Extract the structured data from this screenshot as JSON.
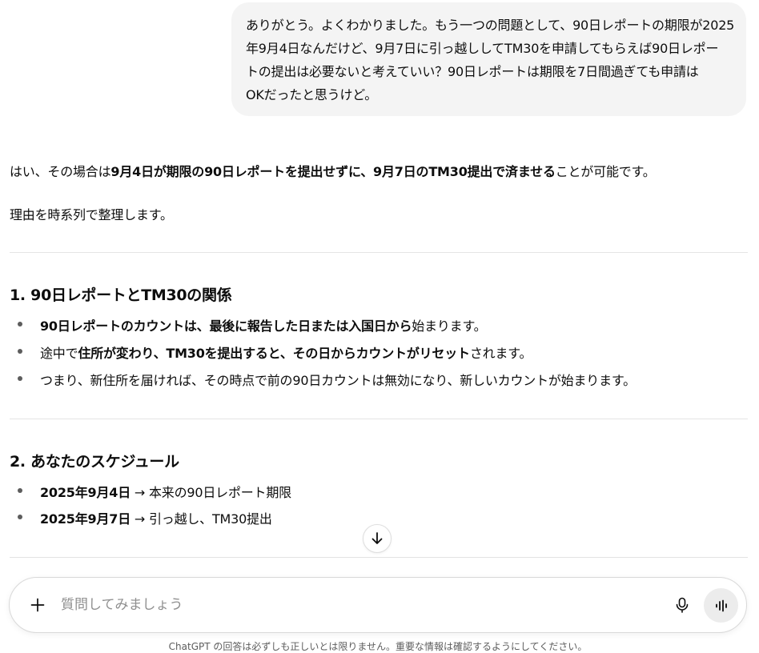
{
  "user_message": {
    "lines": [
      "ありがとう。よくわかりました。もう一つの問題として、90日レポートの期限が2025",
      "年9月4日なんだけど、9月7日に引っ越ししてTM30を申請してもらえば90日レポー",
      "トの提出は必要ないと考えていい？90日レポートは期限を7日間過ぎても申請は",
      "OKだったと思うけど。"
    ]
  },
  "assistant": {
    "intro": {
      "pre": "はい、その場合は",
      "bold": "9月4日が期限の90日レポートを提出せずに、9月7日のTM30提出で済ませる",
      "post": "ことが可能です。"
    },
    "reason": "理由を時系列で整理します。",
    "section1": {
      "heading": "1. 90日レポートとTM30の関係",
      "bullets": [
        {
          "pre": "",
          "bold": "90日レポートのカウントは、最後に報告した日または入国日から",
          "post": "始まります。"
        },
        {
          "pre": "途中で",
          "bold": "住所が変わり、TM30を提出すると、その日からカウントがリセット",
          "post": "されます。"
        },
        {
          "pre": "つまり、新住所を届ければ、その時点で前の90日カウントは無効になり、新しいカウントが始まります。",
          "bold": "",
          "post": ""
        }
      ]
    },
    "section2": {
      "heading": "2. あなたのスケジュール",
      "bullets": [
        {
          "bold": "2025年9月4日",
          "post": " → 本来の90日レポート期限"
        },
        {
          "bold": "2025年9月7日",
          "post": " → 引っ越し、TM30提出"
        }
      ]
    }
  },
  "composer": {
    "placeholder": "質問してみましょう"
  },
  "disclaimer": "ChatGPT の回答は必ずしも正しいとは限りません。重要な情報は確認するようにしてください。"
}
